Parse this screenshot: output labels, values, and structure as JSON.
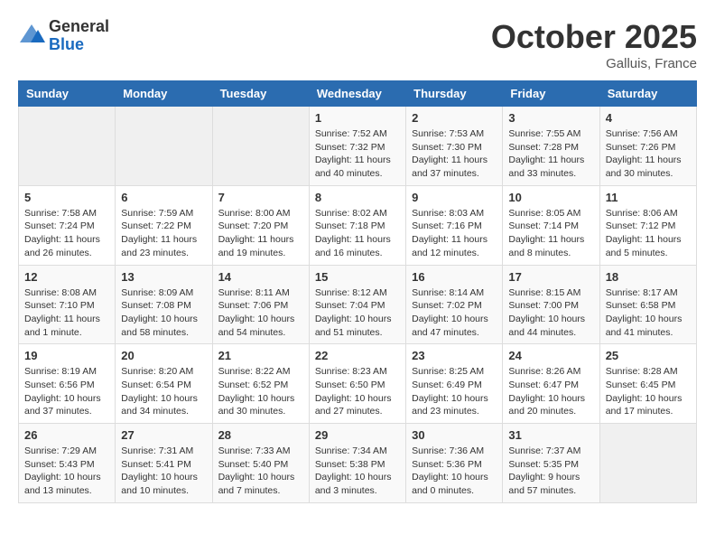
{
  "header": {
    "logo": {
      "general": "General",
      "blue": "Blue"
    },
    "month": "October 2025",
    "location": "Galluis, France"
  },
  "weekdays": [
    "Sunday",
    "Monday",
    "Tuesday",
    "Wednesday",
    "Thursday",
    "Friday",
    "Saturday"
  ],
  "weeks": [
    [
      {
        "day": "",
        "info": ""
      },
      {
        "day": "",
        "info": ""
      },
      {
        "day": "",
        "info": ""
      },
      {
        "day": "1",
        "info": "Sunrise: 7:52 AM\nSunset: 7:32 PM\nDaylight: 11 hours\nand 40 minutes."
      },
      {
        "day": "2",
        "info": "Sunrise: 7:53 AM\nSunset: 7:30 PM\nDaylight: 11 hours\nand 37 minutes."
      },
      {
        "day": "3",
        "info": "Sunrise: 7:55 AM\nSunset: 7:28 PM\nDaylight: 11 hours\nand 33 minutes."
      },
      {
        "day": "4",
        "info": "Sunrise: 7:56 AM\nSunset: 7:26 PM\nDaylight: 11 hours\nand 30 minutes."
      }
    ],
    [
      {
        "day": "5",
        "info": "Sunrise: 7:58 AM\nSunset: 7:24 PM\nDaylight: 11 hours\nand 26 minutes."
      },
      {
        "day": "6",
        "info": "Sunrise: 7:59 AM\nSunset: 7:22 PM\nDaylight: 11 hours\nand 23 minutes."
      },
      {
        "day": "7",
        "info": "Sunrise: 8:00 AM\nSunset: 7:20 PM\nDaylight: 11 hours\nand 19 minutes."
      },
      {
        "day": "8",
        "info": "Sunrise: 8:02 AM\nSunset: 7:18 PM\nDaylight: 11 hours\nand 16 minutes."
      },
      {
        "day": "9",
        "info": "Sunrise: 8:03 AM\nSunset: 7:16 PM\nDaylight: 11 hours\nand 12 minutes."
      },
      {
        "day": "10",
        "info": "Sunrise: 8:05 AM\nSunset: 7:14 PM\nDaylight: 11 hours\nand 8 minutes."
      },
      {
        "day": "11",
        "info": "Sunrise: 8:06 AM\nSunset: 7:12 PM\nDaylight: 11 hours\nand 5 minutes."
      }
    ],
    [
      {
        "day": "12",
        "info": "Sunrise: 8:08 AM\nSunset: 7:10 PM\nDaylight: 11 hours\nand 1 minute."
      },
      {
        "day": "13",
        "info": "Sunrise: 8:09 AM\nSunset: 7:08 PM\nDaylight: 10 hours\nand 58 minutes."
      },
      {
        "day": "14",
        "info": "Sunrise: 8:11 AM\nSunset: 7:06 PM\nDaylight: 10 hours\nand 54 minutes."
      },
      {
        "day": "15",
        "info": "Sunrise: 8:12 AM\nSunset: 7:04 PM\nDaylight: 10 hours\nand 51 minutes."
      },
      {
        "day": "16",
        "info": "Sunrise: 8:14 AM\nSunset: 7:02 PM\nDaylight: 10 hours\nand 47 minutes."
      },
      {
        "day": "17",
        "info": "Sunrise: 8:15 AM\nSunset: 7:00 PM\nDaylight: 10 hours\nand 44 minutes."
      },
      {
        "day": "18",
        "info": "Sunrise: 8:17 AM\nSunset: 6:58 PM\nDaylight: 10 hours\nand 41 minutes."
      }
    ],
    [
      {
        "day": "19",
        "info": "Sunrise: 8:19 AM\nSunset: 6:56 PM\nDaylight: 10 hours\nand 37 minutes."
      },
      {
        "day": "20",
        "info": "Sunrise: 8:20 AM\nSunset: 6:54 PM\nDaylight: 10 hours\nand 34 minutes."
      },
      {
        "day": "21",
        "info": "Sunrise: 8:22 AM\nSunset: 6:52 PM\nDaylight: 10 hours\nand 30 minutes."
      },
      {
        "day": "22",
        "info": "Sunrise: 8:23 AM\nSunset: 6:50 PM\nDaylight: 10 hours\nand 27 minutes."
      },
      {
        "day": "23",
        "info": "Sunrise: 8:25 AM\nSunset: 6:49 PM\nDaylight: 10 hours\nand 23 minutes."
      },
      {
        "day": "24",
        "info": "Sunrise: 8:26 AM\nSunset: 6:47 PM\nDaylight: 10 hours\nand 20 minutes."
      },
      {
        "day": "25",
        "info": "Sunrise: 8:28 AM\nSunset: 6:45 PM\nDaylight: 10 hours\nand 17 minutes."
      }
    ],
    [
      {
        "day": "26",
        "info": "Sunrise: 7:29 AM\nSunset: 5:43 PM\nDaylight: 10 hours\nand 13 minutes."
      },
      {
        "day": "27",
        "info": "Sunrise: 7:31 AM\nSunset: 5:41 PM\nDaylight: 10 hours\nand 10 minutes."
      },
      {
        "day": "28",
        "info": "Sunrise: 7:33 AM\nSunset: 5:40 PM\nDaylight: 10 hours\nand 7 minutes."
      },
      {
        "day": "29",
        "info": "Sunrise: 7:34 AM\nSunset: 5:38 PM\nDaylight: 10 hours\nand 3 minutes."
      },
      {
        "day": "30",
        "info": "Sunrise: 7:36 AM\nSunset: 5:36 PM\nDaylight: 10 hours\nand 0 minutes."
      },
      {
        "day": "31",
        "info": "Sunrise: 7:37 AM\nSunset: 5:35 PM\nDaylight: 9 hours\nand 57 minutes."
      },
      {
        "day": "",
        "info": ""
      }
    ]
  ]
}
